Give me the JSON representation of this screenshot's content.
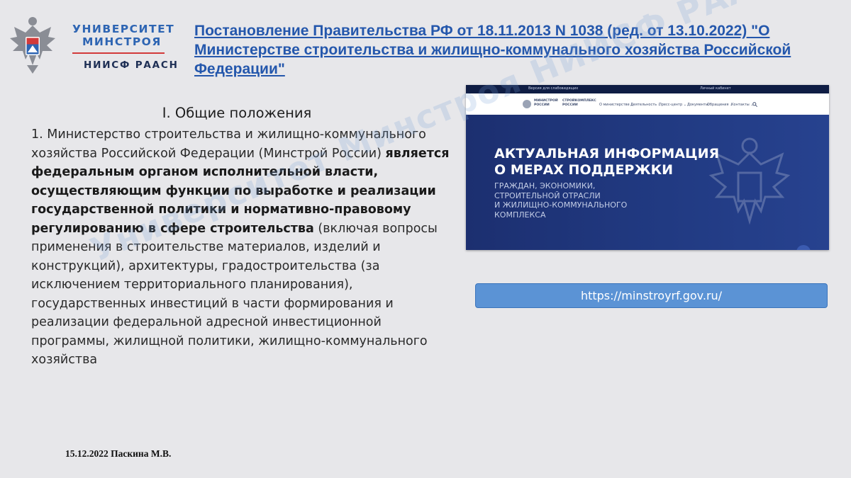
{
  "logo": {
    "line1": "УНИВЕРСИТЕТ",
    "line2": "МИНСТРОЯ",
    "line3": "НИИСФ РААСН"
  },
  "header": {
    "link_text": "Постановление Правительства РФ от 18.11.2013 N 1038 (ред. от 13.10.2022) \"О Министерстве строительства и жилищно-коммунального хозяйства Российской Федерации\""
  },
  "section": {
    "title": "I. Общие положения",
    "para_start": "1. Министерство строительства и жилищно-коммунального хозяйства Российской Федерации (Минстрой России) ",
    "para_bold": "является федеральным органом исполнительной власти, осуществляющим функции по выработке и реализации государственной политики и нормативно-правовому регулированию в сфере строительства",
    "para_end": " (включая вопросы применения в строительстве материалов, изделий и конструкций), архитектуры, градостроительства (за исключением территориального планирования), государственных инвестиций в части формирования и реализации федеральной адресной инвестиционной программы, жилищной политики, жилищно-коммунального хозяйства"
  },
  "website": {
    "topbar_left": "Версия для слабовидящих",
    "topbar_right": "Личный кабинет",
    "brand_1": "МИНИСТРОЙ РОССИИ",
    "brand_2": "СТРОЙКОМПЛЕКС РОССИИ",
    "menu": [
      "О министерстве ⌄",
      "Деятельность ⌄",
      "Пресс-центр ⌄",
      "Документы",
      "Обращения ⌄",
      "Контакты ⌄"
    ],
    "headline_1": "АКТУАЛЬНАЯ ИНФОРМАЦИЯ",
    "headline_2": "О МЕРАХ ПОДДЕРЖКИ",
    "sub_1": "ГРАЖДАН, ЭКОНОМИКИ,",
    "sub_2": "СТРОИТЕЛЬНОЙ ОТРАСЛИ",
    "sub_3": "И ЖИЛИЩНО-КОММУНАЛЬНОГО",
    "sub_4": "КОМПЛЕКСА"
  },
  "url": "https://minstroyrf.gov.ru/",
  "footer": "15.12.2022 Паскина М.В.",
  "watermark": "Университет Минстроя НИИСФ РААСН Паскина М.В.",
  "colors": {
    "background": "#e7e7ea",
    "link": "#2457ac",
    "logo_blue": "#2e65b3",
    "accent_red": "#d23a3a",
    "url_pill": "#5b93d5"
  }
}
